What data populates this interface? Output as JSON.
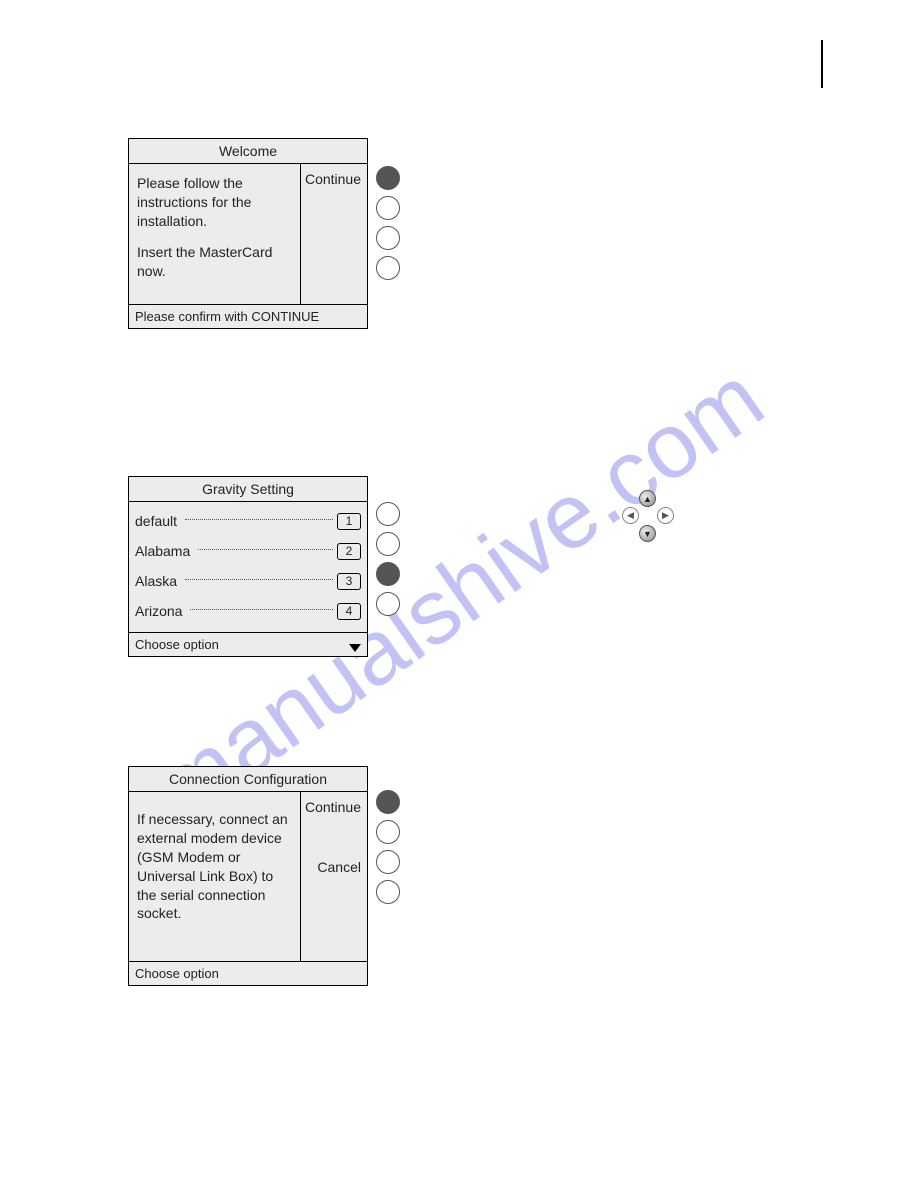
{
  "watermark": "manualshive.com",
  "screens": {
    "welcome": {
      "title": "Welcome",
      "body_line1": "Please follow the instructions for the installation.",
      "body_line2": "Insert the MasterCard now.",
      "softkeys": [
        "Continue",
        "",
        "",
        ""
      ],
      "footer": "Please confirm with CONTINUE",
      "active_button_index": 0
    },
    "gravity": {
      "title": "Gravity Setting",
      "items": [
        {
          "label": "default",
          "num": "1"
        },
        {
          "label": "Alabama",
          "num": "2"
        },
        {
          "label": "Alaska",
          "num": "3"
        },
        {
          "label": "Arizona",
          "num": "4"
        }
      ],
      "footer": "Choose option",
      "active_button_index": 2
    },
    "connection": {
      "title": "Connection Configuration",
      "body": "If necessary, connect an external modem device (GSM Modem or Universal Link Box) to the serial connection socket.",
      "softkeys": [
        "Continue",
        "",
        "Cancel",
        ""
      ],
      "footer": "Choose option",
      "active_button_index": 0
    }
  }
}
